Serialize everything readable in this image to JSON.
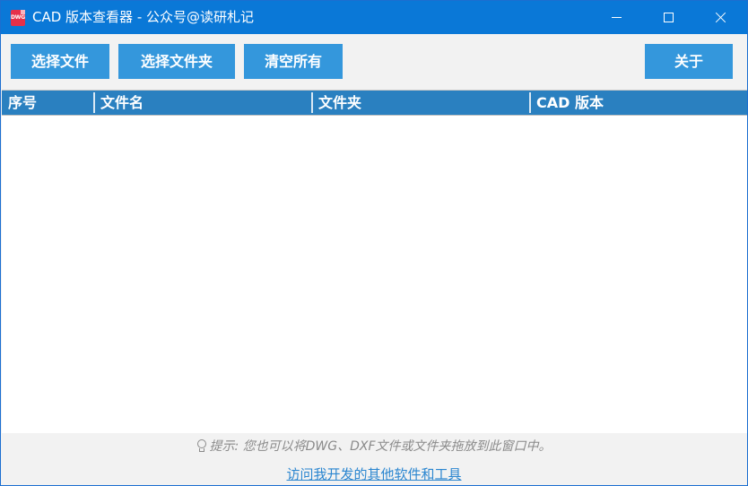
{
  "window": {
    "title": "CAD 版本查看器 - 公众号@读研札记",
    "icon_text": "DWG",
    "accent": "#0a78d7"
  },
  "toolbar": {
    "select_files_label": "选择文件",
    "select_folder_label": "选择文件夹",
    "clear_all_label": "清空所有",
    "about_label": "关于",
    "button_color": "#3497dc"
  },
  "table": {
    "columns": [
      "序号",
      "文件名",
      "文件夹",
      "CAD 版本"
    ],
    "rows": [],
    "header_color": "#2a80c0"
  },
  "footer": {
    "hint": "提示: 您也可以将DWG、DXF文件或文件夹拖放到此窗口中。",
    "hint_icon": "lightbulb-icon",
    "link_text": "访问我开发的其他软件和工具"
  }
}
